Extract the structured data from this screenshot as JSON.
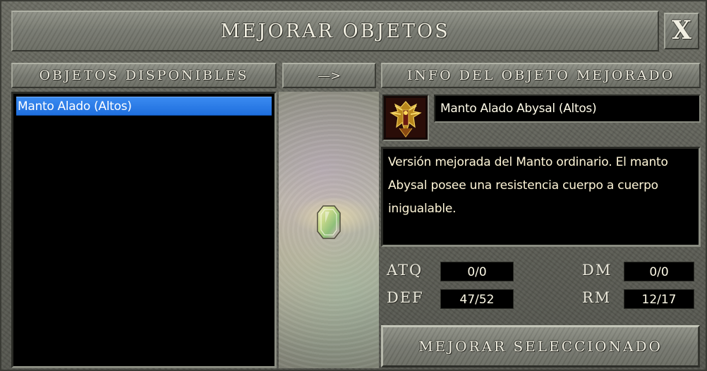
{
  "window": {
    "title": "MEJORAR OBJETOS",
    "close_label": "X"
  },
  "headers": {
    "available": "OBJETOS DISPONIBLES",
    "arrow": "—>",
    "upgraded_info": "INFO DEL OBJETO MEJORADO"
  },
  "available_items": [
    {
      "label": "Manto Alado (Altos)",
      "selected": true
    }
  ],
  "upgraded": {
    "icon": "winged-cloak-icon",
    "name": "Manto Alado Abysal (Altos)",
    "description": "Versión mejorada del Manto ordinario. El manto Abysal posee una resistencia cuerpo a cuerpo inigualable.",
    "stats": {
      "atq": {
        "label": "ATQ",
        "value": "0/0"
      },
      "def": {
        "label": "DEF",
        "value": "47/52"
      },
      "dm": {
        "label": "DM",
        "value": "0/0"
      },
      "rm": {
        "label": "RM",
        "value": "12/17"
      }
    }
  },
  "preview": {
    "icon": "gem-crystal-icon"
  },
  "action": {
    "upgrade_label": "MEJORAR SELECCIONADO"
  },
  "colors": {
    "selection": "#1f6fde",
    "panel_bg": "#000000",
    "stone": "#76786f"
  }
}
